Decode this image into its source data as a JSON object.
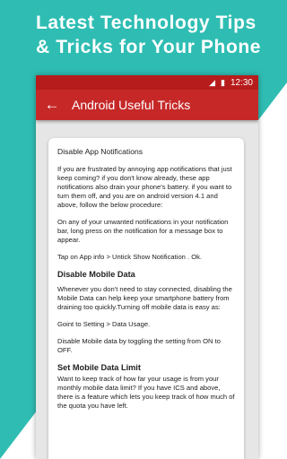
{
  "banner": {
    "line1": "Latest Technology Tips",
    "line2": "& Tricks for Your Phone"
  },
  "status": {
    "time": "12:30",
    "icons": "signal-icon battery-icon"
  },
  "toolbar": {
    "title": "Android Useful Tricks",
    "back_icon": "arrow-back-icon"
  },
  "article": {
    "heading1": "Disable App Notifications",
    "p1": "If you are frustrated by annoying app notifications that just keep coming? if you don't know already, these app notifications also drain your phone's battery. if you want to turn  them off, and you are on android version 4.1 and above, follow the below procedure:",
    "p2": "On any of your unwanted notifications in your notification bar, long press on the notification for a message box to appear.",
    "p3": "Tap on App info > Untick Show Notification . Ok.",
    "heading2": "Disable Mobile Data",
    "p4": "Whenever you don't need to stay connected, disabling the Mobile Data can help keep your smartphone battery from draining too quickly.Turning off mobile data is easy as:",
    "p5": "Goint to Setting > Data Usage.",
    "p6": "Disable Mobile data by toggling  the setting from ON to OFF.",
    "heading3": "Set Mobile Data Limit",
    "p7": "Want to keep track of how far your usage is from your monthly mobile data limit? If you have ICS and above, there is a  feature which lets you keep track of how much of the quota you have left."
  }
}
